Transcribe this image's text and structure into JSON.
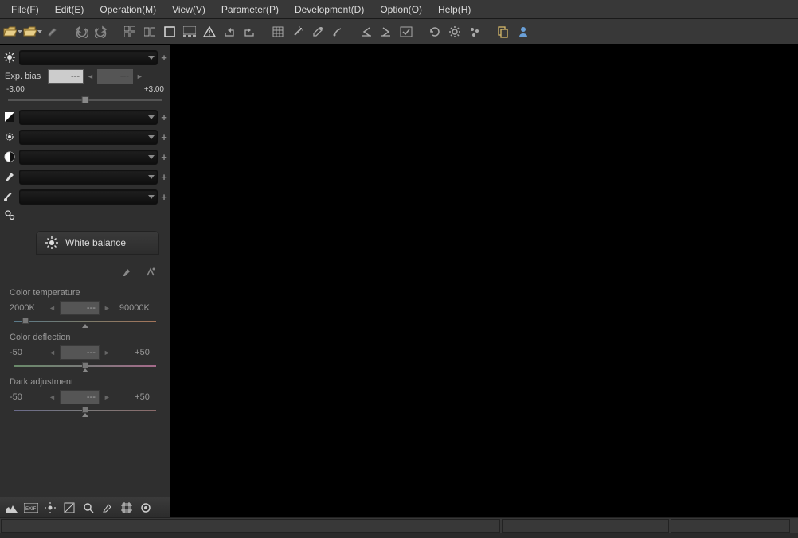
{
  "menubar": [
    {
      "label": "File",
      "mnemonic": "F"
    },
    {
      "label": "Edit",
      "mnemonic": "E"
    },
    {
      "label": "Operation",
      "mnemonic": "M"
    },
    {
      "label": "View",
      "mnemonic": "V"
    },
    {
      "label": "Parameter",
      "mnemonic": "P"
    },
    {
      "label": "Development",
      "mnemonic": "D"
    },
    {
      "label": "Option",
      "mnemonic": "O"
    },
    {
      "label": "Help",
      "mnemonic": "H"
    }
  ],
  "exposure": {
    "label": "Exp. bias",
    "value1": "---",
    "value2": "---",
    "min": "-3.00",
    "max": "+3.00"
  },
  "wb_panel": {
    "title": "White balance",
    "params": [
      {
        "label": "Color temperature",
        "min": "2000K",
        "max": "90000K",
        "value": "---",
        "track": "temp",
        "thumb": "first"
      },
      {
        "label": "Color deflection",
        "min": "-50",
        "max": "+50",
        "value": "---",
        "track": "defl",
        "thumb": "center"
      },
      {
        "label": "Dark adjustment",
        "min": "-50",
        "max": "+50",
        "value": "---",
        "track": "dark",
        "thumb": "center"
      }
    ]
  }
}
